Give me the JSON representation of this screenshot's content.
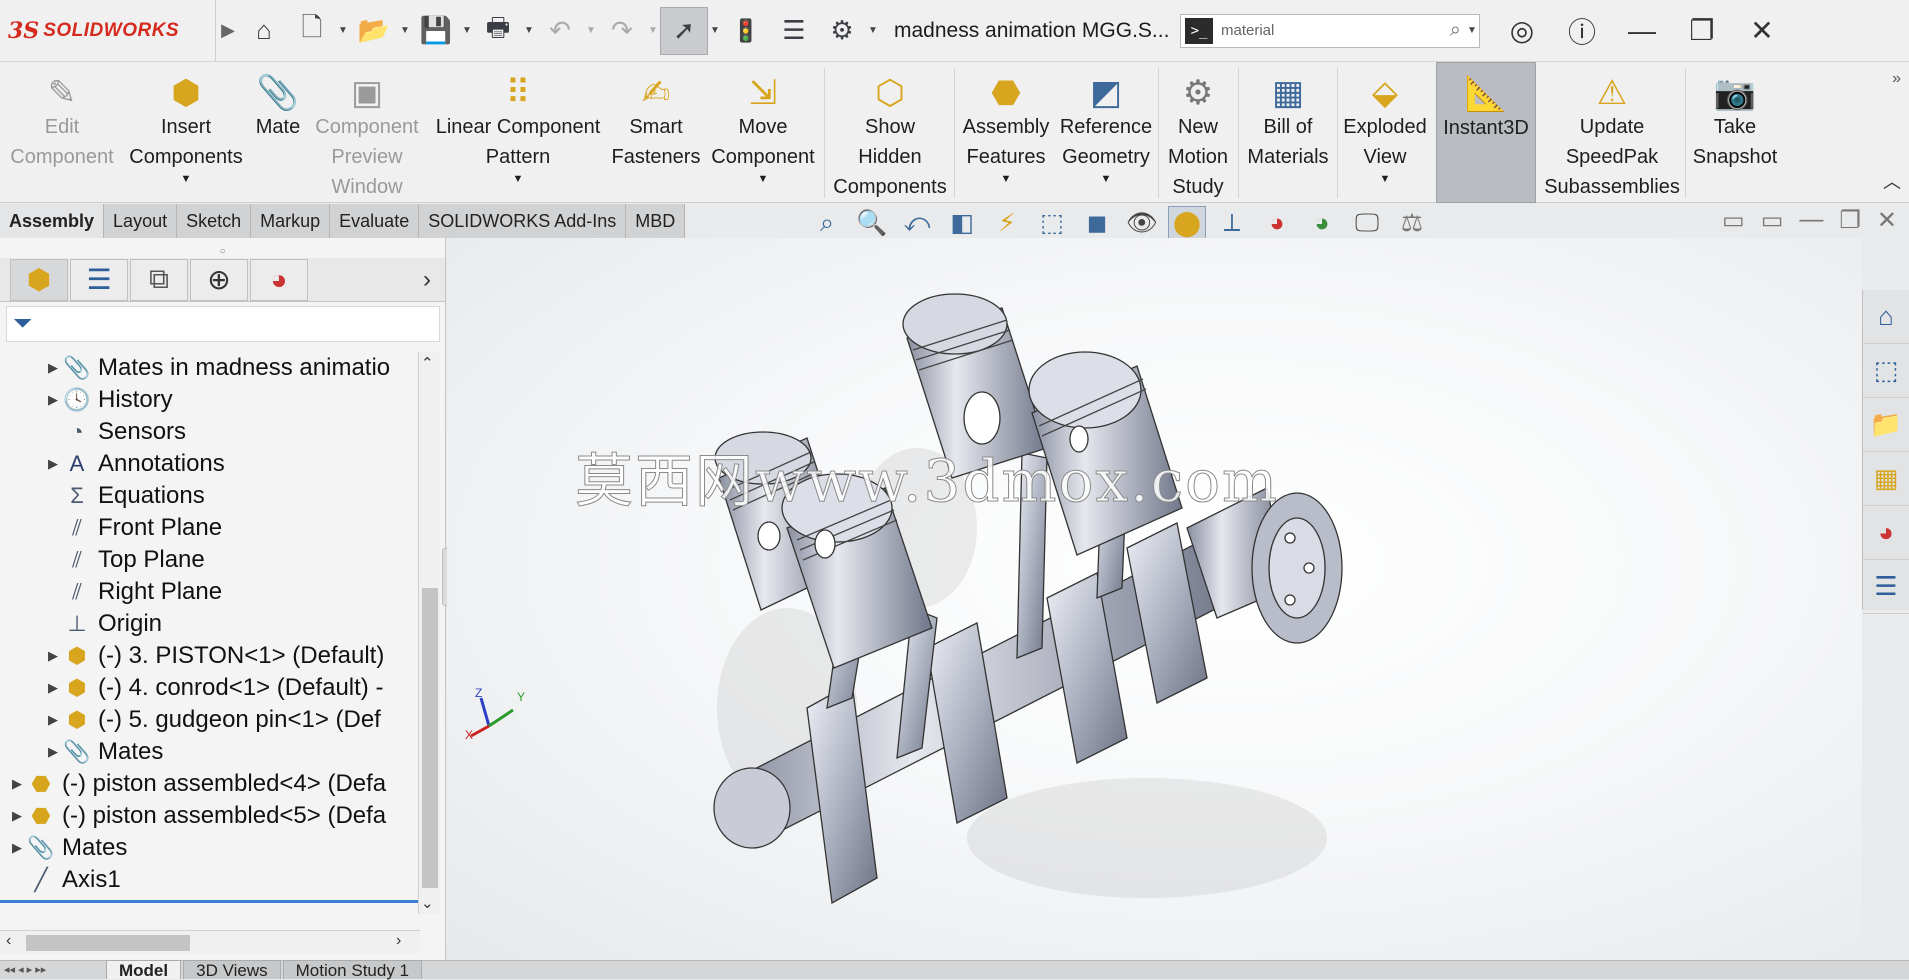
{
  "titlebar": {
    "brand_ds": "3S",
    "brand_name": "SOLIDWORKS",
    "document_title": "madness animation MGG.S...",
    "search": {
      "placeholder": "material",
      "value": "material"
    },
    "icons": [
      "home-icon",
      "new-document-icon",
      "open-icon",
      "save-icon",
      "print-icon",
      "undo-icon",
      "redo-icon",
      "select-arrow-icon",
      "rebuild-traffic-light-icon",
      "file-properties-icon",
      "options-gear-icon",
      "user-account-icon",
      "help-icon",
      "minimize-icon",
      "restore-icon",
      "close-icon"
    ]
  },
  "ribbon": {
    "commands": [
      {
        "id": "edit-component",
        "label_lines": [
          "Edit",
          "Component"
        ],
        "icon": "edit-component-icon",
        "disabled": true
      },
      {
        "id": "insert-components",
        "label_lines": [
          "Insert",
          "Components"
        ],
        "icon": "insert-components-icon",
        "dropdown": true
      },
      {
        "id": "mate",
        "label_lines": [
          "Mate"
        ],
        "icon": "paperclip-icon"
      },
      {
        "id": "component-preview-window",
        "label_lines": [
          "Component",
          "Preview",
          "Window"
        ],
        "icon": "preview-window-icon",
        "disabled": true
      },
      {
        "id": "linear-component-pattern",
        "label_lines": [
          "Linear Component",
          "Pattern"
        ],
        "icon": "linear-pattern-icon",
        "dropdown": true
      },
      {
        "id": "smart-fasteners",
        "label_lines": [
          "Smart",
          "Fasteners"
        ],
        "icon": "smart-fasteners-icon"
      },
      {
        "id": "move-component",
        "label_lines": [
          "Move",
          "Component"
        ],
        "icon": "move-component-icon",
        "dropdown": true
      },
      {
        "id": "show-hidden-components",
        "label_lines": [
          "Show",
          "Hidden",
          "Components"
        ],
        "icon": "show-hidden-icon"
      },
      {
        "id": "assembly-features",
        "label_lines": [
          "Assembly",
          "Features"
        ],
        "icon": "assembly-features-icon",
        "dropdown": true
      },
      {
        "id": "reference-geometry",
        "label_lines": [
          "Reference",
          "Geometry"
        ],
        "icon": "reference-geometry-icon",
        "dropdown": true
      },
      {
        "id": "new-motion-study",
        "label_lines": [
          "New",
          "Motion",
          "Study"
        ],
        "icon": "motion-gears-icon"
      },
      {
        "id": "bill-of-materials",
        "label_lines": [
          "Bill of",
          "Materials"
        ],
        "icon": "bill-of-materials-icon"
      },
      {
        "id": "exploded-view",
        "label_lines": [
          "Exploded",
          "View"
        ],
        "icon": "exploded-view-icon",
        "dropdown": true
      },
      {
        "id": "instant3d",
        "label_lines": [
          "Instant3D"
        ],
        "icon": "instant3d-icon",
        "active": true
      },
      {
        "id": "update-speedpak",
        "label_lines": [
          "Update",
          "SpeedPak",
          "Subassemblies"
        ],
        "icon": "speedpak-warning-icon"
      },
      {
        "id": "take-snapshot",
        "label_lines": [
          "Take",
          "Snapshot"
        ],
        "icon": "camera-icon"
      }
    ]
  },
  "cm_tabs": [
    "Assembly",
    "Layout",
    "Sketch",
    "Markup",
    "Evaluate",
    "SOLIDWORKS Add-Ins",
    "MBD"
  ],
  "cm_active": "Assembly",
  "hud_icons": [
    "zoom-to-fit-icon",
    "zoom-to-area-icon",
    "previous-view-icon",
    "section-view-icon",
    "dynamic-annotation-icon",
    "view-orientation-icon",
    "display-style-icon",
    "hide-show-items-icon",
    "edit-appearance-icon",
    "apply-scene-icon",
    "view-settings-icon",
    "display-manager-icon",
    "monitor-icon",
    "balance-icon"
  ],
  "feature_tree": {
    "nodes": [
      {
        "label": "Mates in madness animatio",
        "icon": "mates-folder-icon",
        "depth": 1,
        "expandable": true
      },
      {
        "label": "History",
        "icon": "history-icon",
        "depth": 1,
        "expandable": true
      },
      {
        "label": "Sensors",
        "icon": "sensors-icon",
        "depth": 1,
        "expandable": false
      },
      {
        "label": "Annotations",
        "icon": "annotations-icon",
        "depth": 1,
        "expandable": true
      },
      {
        "label": "Equations",
        "icon": "equations-icon",
        "depth": 1,
        "expandable": false
      },
      {
        "label": "Front Plane",
        "icon": "plane-icon",
        "depth": 1,
        "expandable": false
      },
      {
        "label": "Top Plane",
        "icon": "plane-icon",
        "depth": 1,
        "expandable": false
      },
      {
        "label": "Right Plane",
        "icon": "plane-icon",
        "depth": 1,
        "expandable": false
      },
      {
        "label": "Origin",
        "icon": "origin-icon",
        "depth": 1,
        "expandable": false
      },
      {
        "label": "(-) 3. PISTON<1> (Default)",
        "icon": "part-icon",
        "depth": 1,
        "expandable": true
      },
      {
        "label": "(-) 4. conrod<1> (Default) -",
        "icon": "part-icon",
        "depth": 1,
        "expandable": true
      },
      {
        "label": "(-) 5. gudgeon pin<1> (Def",
        "icon": "part-icon",
        "depth": 1,
        "expandable": true
      },
      {
        "label": "Mates",
        "icon": "mates-icon",
        "depth": 1,
        "expandable": true
      },
      {
        "label": "(-) piston assembled<4> (Defa",
        "icon": "subassembly-icon",
        "depth": 0,
        "expandable": true
      },
      {
        "label": "(-) piston assembled<5> (Defa",
        "icon": "subassembly-icon",
        "depth": 0,
        "expandable": true
      },
      {
        "label": "Mates",
        "icon": "mates-icon",
        "depth": 0,
        "expandable": true
      },
      {
        "label": "Axis1",
        "icon": "axis-icon",
        "depth": 0,
        "expandable": false
      }
    ]
  },
  "viewport": {
    "watermark": "莫西网www.3dmox.com",
    "triad_labels": [
      "Z",
      "Y",
      "X"
    ]
  },
  "bottom_tabs": [
    "Model",
    "3D Views",
    "Motion Study 1"
  ],
  "bottom_active": "Model"
}
